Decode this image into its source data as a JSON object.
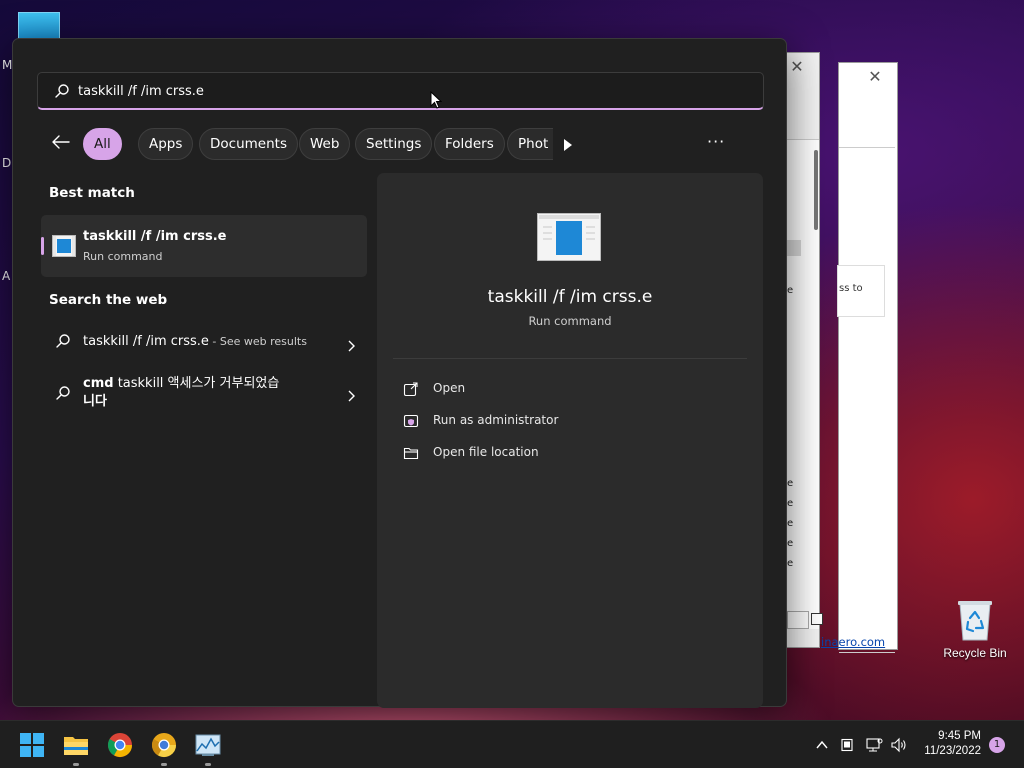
{
  "desktop": {
    "left_labels": [
      "M",
      "Da",
      "A"
    ],
    "recycle_bin_label": "Recycle Bin"
  },
  "background_window": {
    "text_ss_to": "ss to",
    "link_text": "inaero.com",
    "list_chars": [
      "e",
      "e",
      "e",
      "e",
      "e",
      "e"
    ]
  },
  "search": {
    "query": "taskkill /f /im crss.e"
  },
  "filters": [
    {
      "label": "All"
    },
    {
      "label": "Apps"
    },
    {
      "label": "Documents"
    },
    {
      "label": "Web"
    },
    {
      "label": "Settings"
    },
    {
      "label": "Folders"
    },
    {
      "label": "Phot"
    }
  ],
  "more_label": "···",
  "best_match": {
    "section_title": "Best match",
    "title": "taskkill /f /im crss.e",
    "subtitle": "Run command"
  },
  "web": {
    "section_title": "Search the web",
    "results": [
      {
        "text": "taskkill /f /im crss.e",
        "suffix": " - See web results"
      },
      {
        "bold": "cmd",
        "text": " taskkill 액세스가 거부되었습",
        "line2": "니다"
      }
    ]
  },
  "detail": {
    "title": "taskkill /f /im crss.e",
    "subtitle": "Run command",
    "actions": [
      {
        "label": "Open",
        "icon": "open-external-icon"
      },
      {
        "label": "Run as administrator",
        "icon": "shield-admin-icon"
      },
      {
        "label": "Open file location",
        "icon": "folder-icon"
      }
    ]
  },
  "taskbar": {
    "apps": [
      "windows-start-icon",
      "file-explorer-icon",
      "chrome-icon",
      "chrome-canary-icon",
      "resource-monitor-icon"
    ],
    "clock_time": "9:45 PM",
    "clock_date": "11/23/2022",
    "notification_count": "1"
  },
  "colors": {
    "accent": "#d7a4e8",
    "flyout_bg": "#202020",
    "panel_bg": "#2b2b2b"
  }
}
